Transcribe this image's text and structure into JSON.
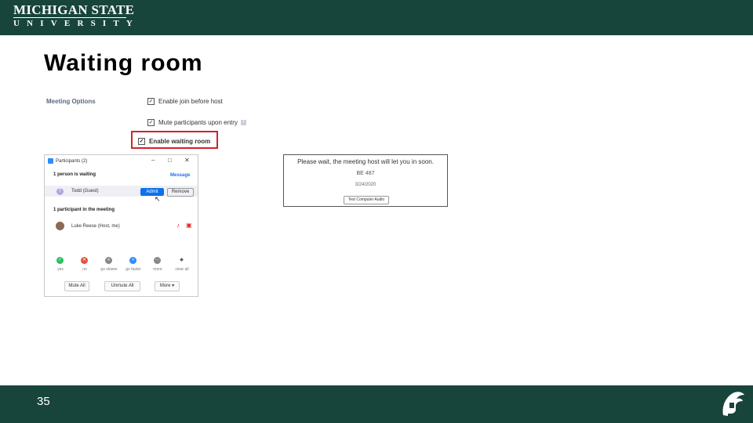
{
  "header": {
    "logo_line1": "MICHIGAN STATE",
    "logo_line2": "UNIVERSITY",
    "bar_color": "#18453b"
  },
  "slide": {
    "title": "Waiting room",
    "number": "35"
  },
  "meeting_options": {
    "label": "Meeting Options",
    "options": [
      {
        "label": "Enable join before host",
        "checked": true
      },
      {
        "label": "Mute participants upon entry",
        "checked": true
      },
      {
        "label": "Enable waiting room",
        "checked": true
      }
    ],
    "highlight_color": "#d0232b"
  },
  "participants_window": {
    "title": "Participants (2)",
    "waiting_header": "1 person is waiting",
    "message_link": "Message",
    "waiting_person": "Todd (Guest)",
    "waiting_initial": "T",
    "admit_label": "Admit",
    "remove_label": "Remove",
    "in_meeting_header": "1 participant in the meeting",
    "host_name": "Luke Reese (Host, me)",
    "reactions": [
      {
        "label": "yes",
        "symbol": "✓",
        "color": "#2dbe60"
      },
      {
        "label": "no",
        "symbol": "✕",
        "color": "#e2533f"
      },
      {
        "label": "go slower",
        "symbol": "«",
        "color": "#888888"
      },
      {
        "label": "go faster",
        "symbol": "»",
        "color": "#2d8cff"
      },
      {
        "label": "more",
        "symbol": "···",
        "color": "#888888"
      },
      {
        "label": "clear all",
        "symbol": "◆",
        "color": "#ffffff"
      }
    ],
    "footer_buttons": [
      "Mute All",
      "Unmute All",
      "More ▾"
    ]
  },
  "waiting_screen": {
    "message": "Please wait, the meeting host will let you in soon.",
    "meeting_id": "BE 487",
    "date": "3/24/2020",
    "test_audio_label": "Test Computer Audio"
  }
}
